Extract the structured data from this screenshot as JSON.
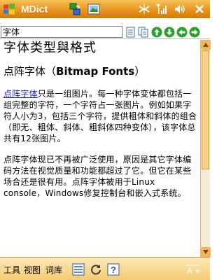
{
  "titlebar": {
    "title": "MDict",
    "bg": "#e7941d"
  },
  "statusbar": {
    "icons": [
      "windows-logo-icon",
      "app-switch-icon",
      "photo-icon",
      "connectivity-icon",
      "signal-icon",
      "volume-icon",
      "close-icon"
    ]
  },
  "search": {
    "value": "字体"
  },
  "article": {
    "title": "字体类型與格式",
    "subtitle_prefix": "点阵字体（",
    "subtitle_bold": "Bitmap Fonts",
    "subtitle_suffix": "）",
    "p1_link": "点阵字体",
    "p1_text": "只是一组图片。每一种字体变体都包括一组完整的字符，一个字符占一张图片。例如如果字符人小为3，包括三个字符，提供粗体和斜体的组合（即无、粗体、斜体、粗斜体四种变体），该字体总共有12张图片。",
    "p2_text": "点阵字体现已不再被广泛使用，原因是其它字体编码方法在视觉质量和功能都超过了它。但它在某些场合还是很有用。点阵字体被用于Linux console，Windows修复控制台和嵌入式系统。"
  },
  "bottombar": {
    "menu": [
      "工具",
      "视图",
      "词库"
    ]
  },
  "colors": {
    "accent": "#e7941d",
    "link": "#1a1ad8",
    "go_button": "#2aa22a"
  }
}
